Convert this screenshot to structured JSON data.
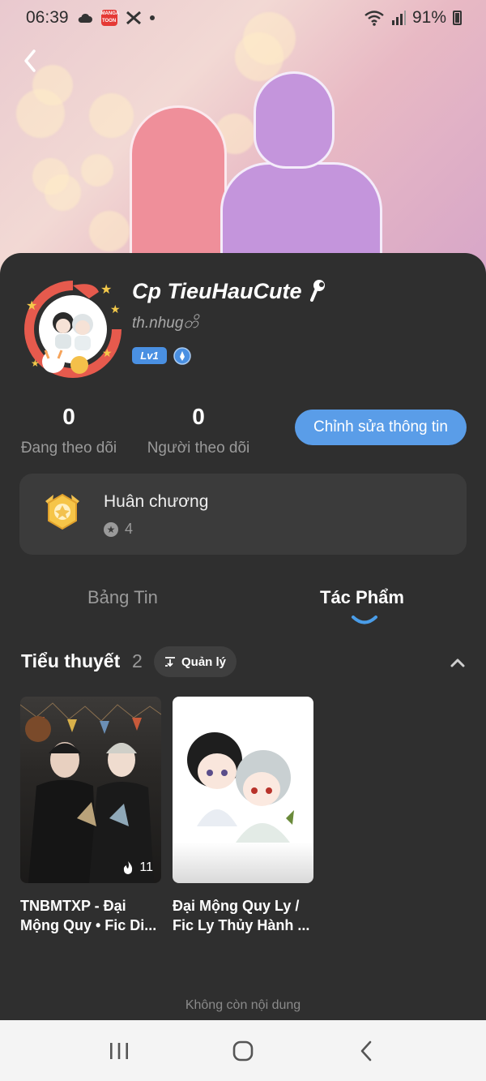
{
  "status_bar": {
    "time": "06:39",
    "battery": "91%",
    "icons": [
      "cloud-icon",
      "manga-toon-app-icon",
      "capcut-icon",
      "notification-dot",
      "wifi-icon",
      "signal-icon",
      "battery-icon"
    ]
  },
  "profile": {
    "name": "Cp TieuHauCute",
    "username": "th.nhugတိ",
    "level_badge": "Lv1",
    "colors": {
      "accent": "#5a9de8",
      "background": "#2f2f2f",
      "card": "#3b3b3b"
    }
  },
  "stats": {
    "following_count": "0",
    "following_label": "Đang theo dõi",
    "followers_count": "0",
    "followers_label": "Người theo dõi"
  },
  "edit_button": "Chỉnh sửa thông tin",
  "medal": {
    "title": "Huân chương",
    "count": "4"
  },
  "tabs": [
    {
      "label": "Bảng Tin",
      "active": false
    },
    {
      "label": "Tác Phẩm",
      "active": true
    }
  ],
  "section": {
    "title": "Tiểu thuyết",
    "count": "2",
    "manage_label": "Quản lý"
  },
  "works": [
    {
      "title_line1": "TNBMTXP - Đại",
      "title_line2": "Mộng Quy • Fic Di...",
      "hot_count": "11"
    },
    {
      "title_line1": "Đại Mộng Quy Ly /",
      "title_line2": "Fic Ly Thủy Hành ..."
    }
  ],
  "end_text": "Không còn nội dung"
}
